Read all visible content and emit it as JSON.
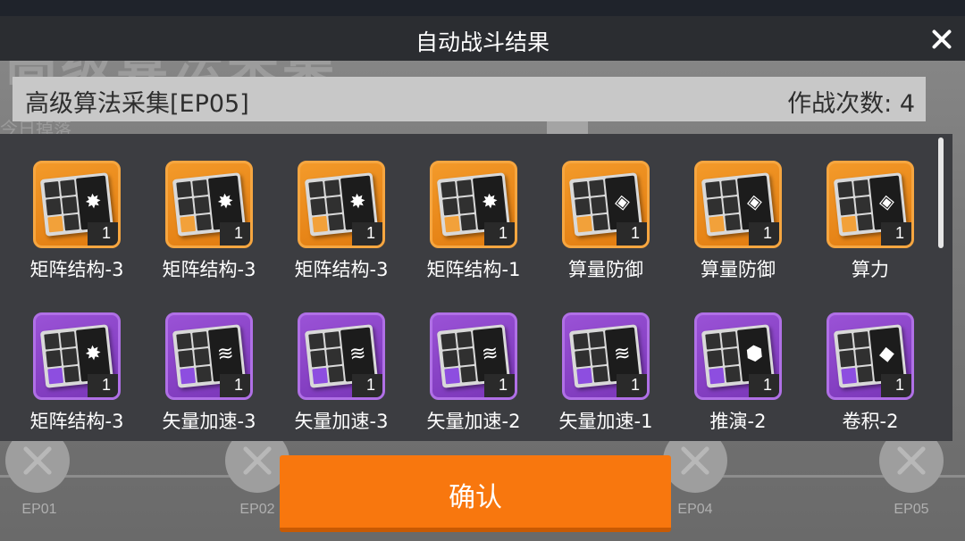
{
  "background": {
    "stage_title": "高级算法采集",
    "sub_text": "今日掉落",
    "ep_labels": [
      "EP01",
      "EP02",
      "EP04",
      "EP05"
    ]
  },
  "dialog": {
    "title": "自动战斗结果",
    "stage_name": "高级算法采集[EP05]",
    "battle_count": "作战次数: 4",
    "confirm_label": "确认",
    "close_icon": "close-icon"
  },
  "rarity_colors": {
    "orange": "#f39a2a",
    "purple": "#9a52d6",
    "confirm": "#f8770e"
  },
  "rewards": [
    {
      "name": "矩阵结构-3",
      "count": "1",
      "rarity": "orange",
      "symbol": "✸"
    },
    {
      "name": "矩阵结构-3",
      "count": "1",
      "rarity": "orange",
      "symbol": "✸"
    },
    {
      "name": "矩阵结构-3",
      "count": "1",
      "rarity": "orange",
      "symbol": "✸"
    },
    {
      "name": "矩阵结构-1",
      "count": "1",
      "rarity": "orange",
      "symbol": "✸"
    },
    {
      "name": "算量防御",
      "count": "1",
      "rarity": "orange",
      "symbol": "◈"
    },
    {
      "name": "算量防御",
      "count": "1",
      "rarity": "orange",
      "symbol": "◈"
    },
    {
      "name": "算力",
      "count": "1",
      "rarity": "orange",
      "symbol": "◈"
    },
    {
      "name": "矩阵结构-3",
      "count": "1",
      "rarity": "purple",
      "symbol": "✸"
    },
    {
      "name": "矢量加速-3",
      "count": "1",
      "rarity": "purple",
      "symbol": "≋"
    },
    {
      "name": "矢量加速-3",
      "count": "1",
      "rarity": "purple",
      "symbol": "≋"
    },
    {
      "name": "矢量加速-2",
      "count": "1",
      "rarity": "purple",
      "symbol": "≋"
    },
    {
      "name": "矢量加速-1",
      "count": "1",
      "rarity": "purple",
      "symbol": "≋"
    },
    {
      "name": "推演-2",
      "count": "1",
      "rarity": "purple",
      "symbol": "⬢"
    },
    {
      "name": "卷积-2",
      "count": "1",
      "rarity": "purple",
      "symbol": "◆"
    }
  ]
}
